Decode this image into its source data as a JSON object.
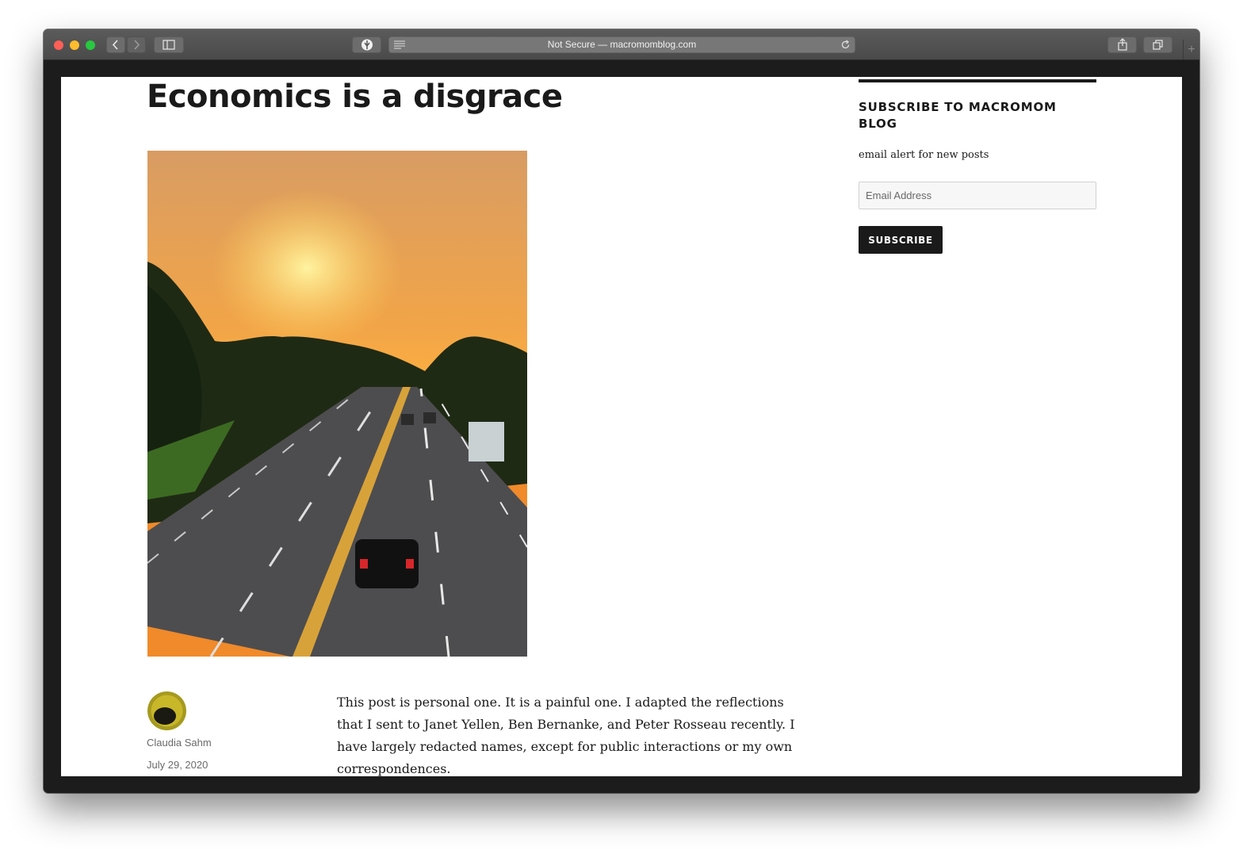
{
  "browser": {
    "address": "Not Secure — macromomblog.com",
    "icons": [
      "back-icon",
      "forward-icon",
      "sidebar-icon",
      "privacy-shield-icon",
      "reader-icon",
      "reload-icon",
      "share-icon",
      "tabs-icon",
      "new-tab-icon"
    ]
  },
  "post": {
    "title": "Economics is a disgrace",
    "image": "featured photo of a highway at sunset",
    "author": "Claudia Sahm",
    "date": "July 29, 2020",
    "body": "This post is personal one. It is a painful one. I adapted the reflections that I sent to Janet Yellen, Ben Bernanke, and Peter Rosseau recently. I have largely redacted names, except for public interactions or my own correspondences."
  },
  "sidebar": {
    "widget_title": "SUBSCRIBE TO MACROMOM BLOG",
    "description": "email alert for new posts",
    "email_placeholder": "Email Address",
    "subscribe_label": "SUBSCRIBE"
  },
  "colors": {
    "traffic_red": "#fe5f57",
    "traffic_yellow": "#febc2e",
    "traffic_green": "#28c840",
    "text": "#1a1a1a",
    "button_bg": "#1a1a1a",
    "meta_text": "#6a6a6a"
  }
}
